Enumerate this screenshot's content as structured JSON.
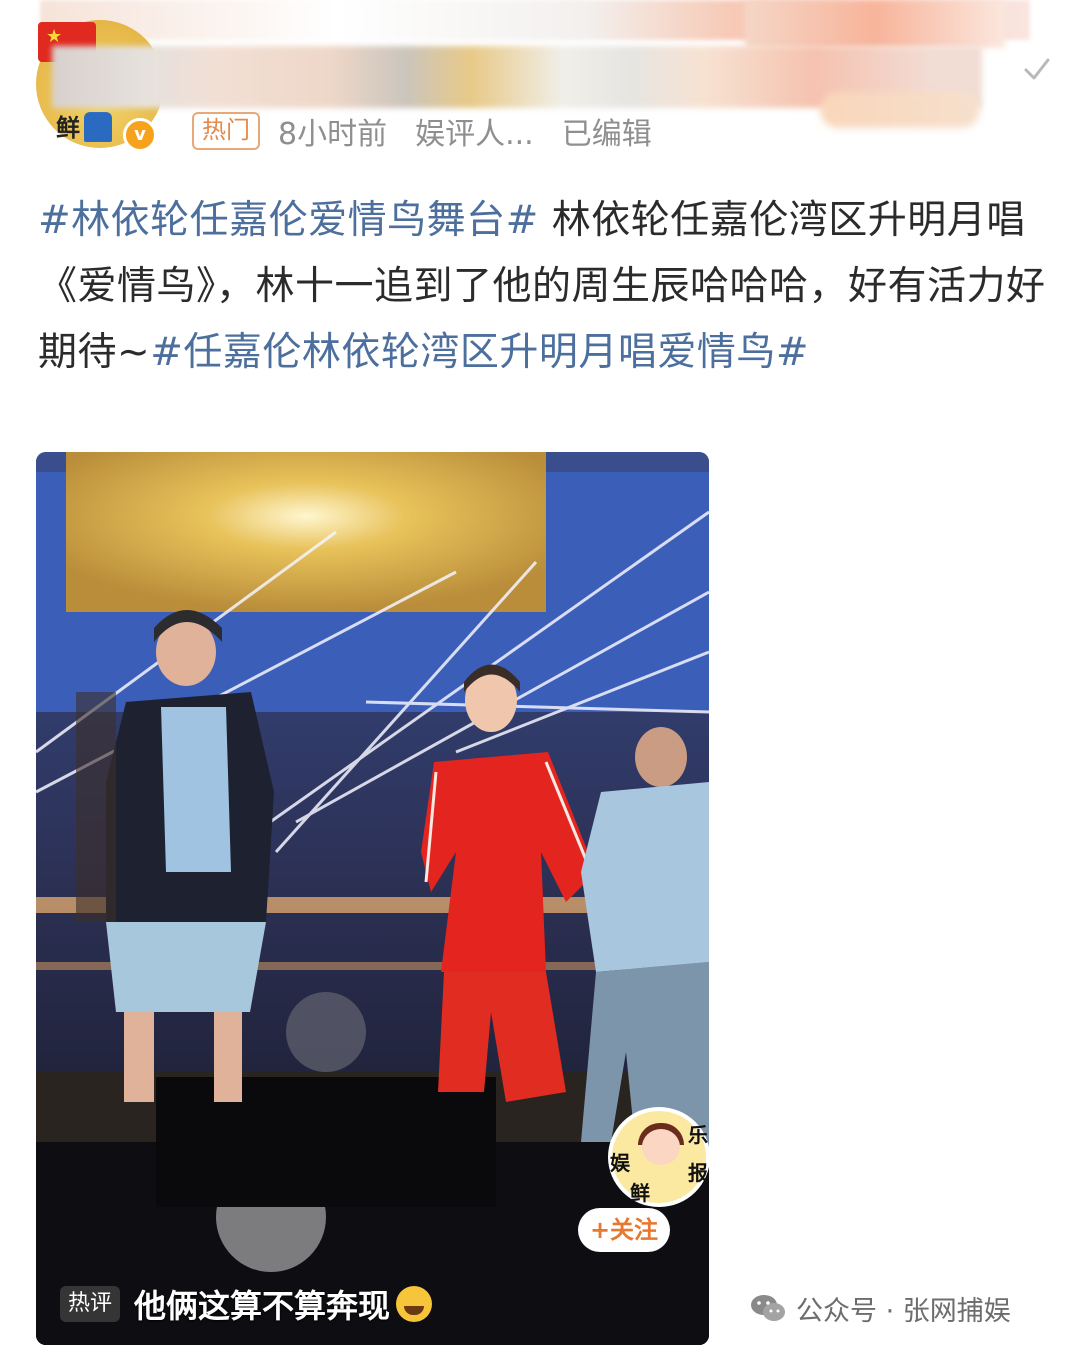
{
  "post": {
    "meta": {
      "hot_badge": "热门",
      "time": "8小时前",
      "source": "娱评人...",
      "edited": "已编辑"
    },
    "body": {
      "tag1": "#林依轮任嘉伦爱情鸟舞台#",
      "text": "林依轮任嘉伦湾区升明月唱《爱情鸟》，林十一追到了他的周生辰哈哈哈，好有活力好期待~",
      "tag2": "#任嘉伦林依轮湾区升明月唱爱情鸟#"
    }
  },
  "avatar": {
    "badge_text": "鲜"
  },
  "video": {
    "sticker": {
      "char_left": "娱",
      "char_top_right": "乐",
      "char_right": "报",
      "char_bottom": "鲜"
    },
    "follow_button": "+关注",
    "hot_comment": {
      "badge": "热评",
      "text": "他俩这算不算奔现"
    }
  },
  "watermark": {
    "text": "公众号 · 张网捕娱"
  },
  "colors": {
    "hashtag": "#4c6f9d",
    "hot_badge": "#e48a4b",
    "meta_gray": "#8f8f8f",
    "follow_orange": "#e8782f",
    "verified": "#f7a21b"
  },
  "icons": [
    "verified-icon",
    "chevron-down-icon",
    "laugh-cry-emoji-icon",
    "wechat-icon"
  ]
}
